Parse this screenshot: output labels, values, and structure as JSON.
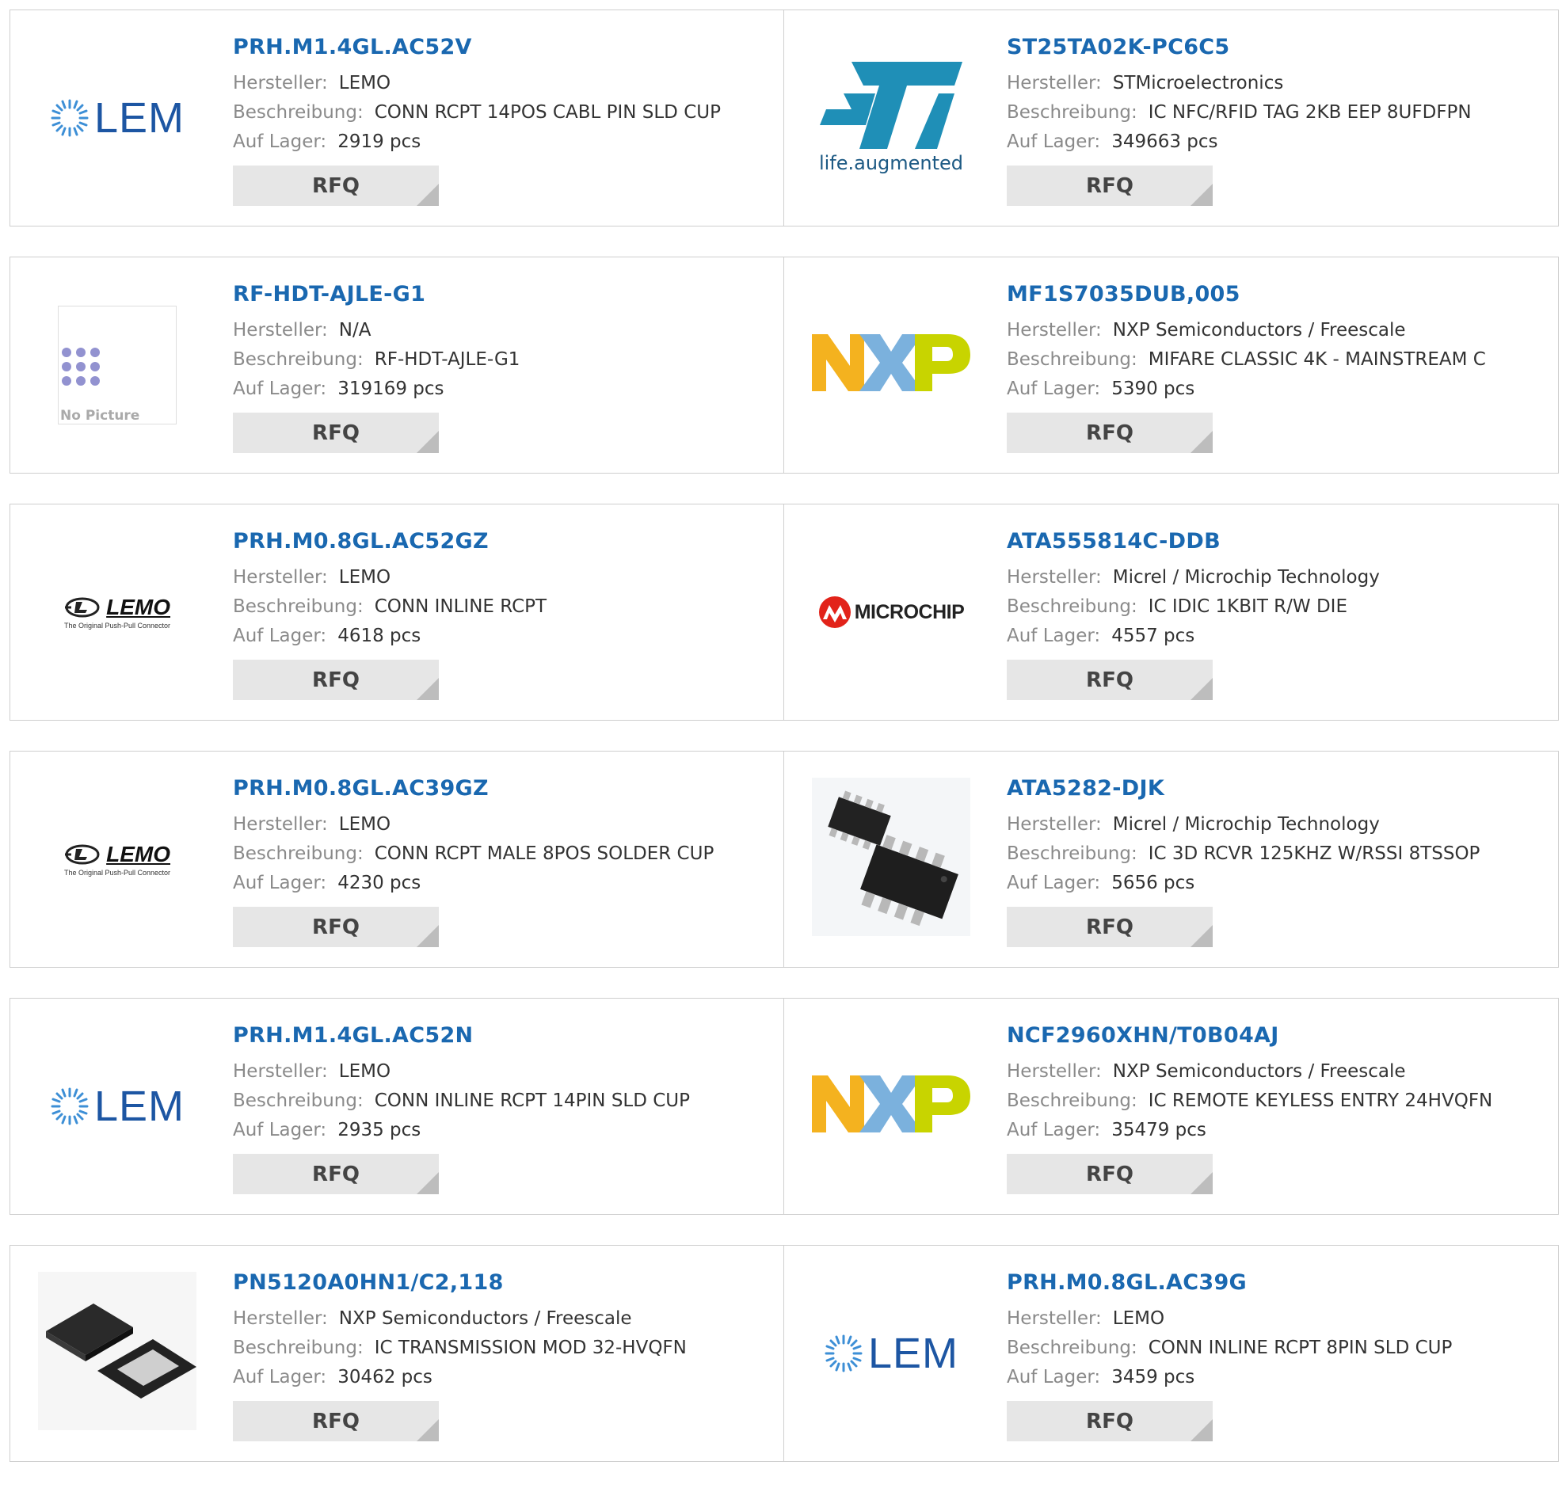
{
  "labels": {
    "manufacturer": "Hersteller:",
    "description": "Beschreibung:",
    "stock": "Auf Lager:",
    "rfq": "RFQ",
    "no_picture": "No Picture"
  },
  "logos": {
    "lem": "LEM",
    "st_tagline": "life.augmented",
    "nxp": "NXP",
    "microchip": "MICROCHIP",
    "lemo": "LEMO",
    "lemo_tagline": "The Original Push-Pull Connector"
  },
  "colors": {
    "part_link": "#1a68b0",
    "label": "#8a8a8a",
    "value": "#333333",
    "rfq_bg": "#e6e6e6",
    "border": "#cfcfcf"
  },
  "products": [
    {
      "part": "PRH.M1.4GL.AC52V",
      "manufacturer": "LEMO",
      "description": "CONN RCPT 14POS CABL PIN SLD CUP",
      "stock": "2919 pcs",
      "logo": "lem-logo"
    },
    {
      "part": "ST25TA02K-PC6C5",
      "manufacturer": "STMicroelectronics",
      "description": "IC NFC/RFID TAG 2KB EEP 8UFDFPN",
      "stock": "349663 pcs",
      "logo": "st-logo"
    },
    {
      "part": "RF-HDT-AJLE-G1",
      "manufacturer": "N/A",
      "description": "RF-HDT-AJLE-G1",
      "stock": "319169 pcs",
      "logo": "no-picture"
    },
    {
      "part": "MF1S7035DUB,005",
      "manufacturer": "NXP Semiconductors / Freescale",
      "description": "MIFARE CLASSIC 4K - MAINSTREAM C",
      "stock": "5390 pcs",
      "logo": "nxp-logo"
    },
    {
      "part": "PRH.M0.8GL.AC52GZ",
      "manufacturer": "LEMO",
      "description": "CONN INLINE RCPT",
      "stock": "4618 pcs",
      "logo": "lemo-logo"
    },
    {
      "part": "ATA555814C-DDB",
      "manufacturer": "Micrel / Microchip Technology",
      "description": "IC IDIC 1KBIT R/W DIE",
      "stock": "4557 pcs",
      "logo": "microchip-logo"
    },
    {
      "part": "PRH.M0.8GL.AC39GZ",
      "manufacturer": "LEMO",
      "description": "CONN RCPT MALE 8POS SOLDER CUP",
      "stock": "4230 pcs",
      "logo": "lemo-logo"
    },
    {
      "part": "ATA5282-DJK",
      "manufacturer": "Micrel / Microchip Technology",
      "description": "IC 3D RCVR 125KHZ W/RSSI 8TSSOP",
      "stock": "5656 pcs",
      "logo": "tssop-chip-image"
    },
    {
      "part": "PRH.M1.4GL.AC52N",
      "manufacturer": "LEMO",
      "description": "CONN INLINE RCPT 14PIN SLD CUP",
      "stock": "2935 pcs",
      "logo": "lem-logo"
    },
    {
      "part": "NCF2960XHN/T0B04AJ",
      "manufacturer": "NXP Semiconductors / Freescale",
      "description": "IC REMOTE KEYLESS ENTRY 24HVQFN",
      "stock": "35479 pcs",
      "logo": "nxp-logo"
    },
    {
      "part": "PN5120A0HN1/C2,118",
      "manufacturer": "NXP Semiconductors / Freescale",
      "description": "IC TRANSMISSION MOD 32-HVQFN",
      "stock": "30462 pcs",
      "logo": "qfn-chip-image"
    },
    {
      "part": "PRH.M0.8GL.AC39G",
      "manufacturer": "LEMO",
      "description": "CONN INLINE RCPT 8PIN SLD CUP",
      "stock": "3459 pcs",
      "logo": "lem-logo"
    }
  ]
}
